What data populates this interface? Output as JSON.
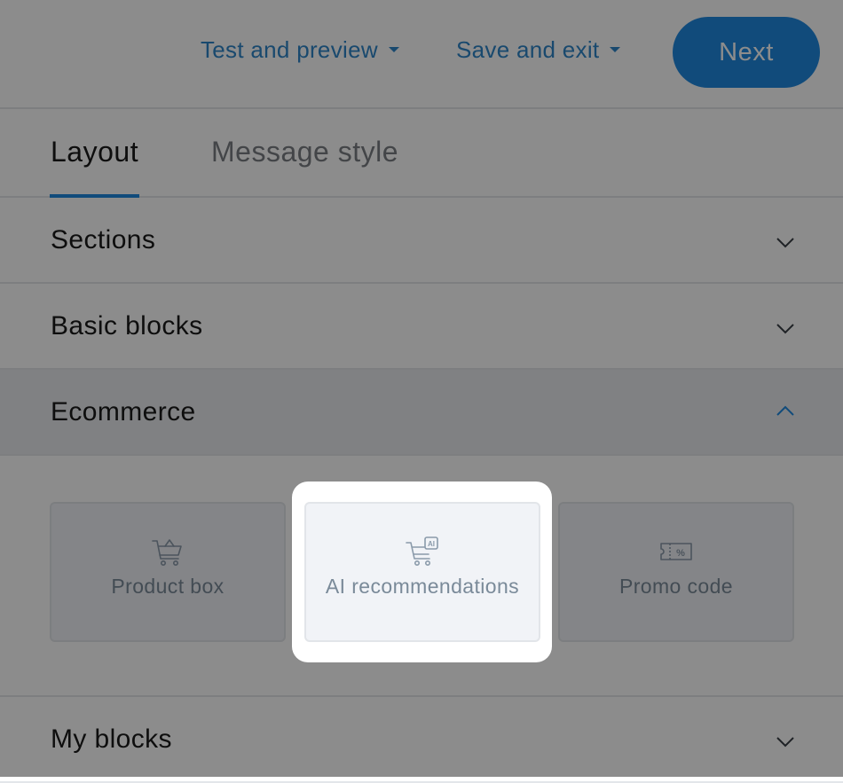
{
  "header": {
    "test_preview_label": "Test and preview",
    "save_exit_label": "Save and exit",
    "next_label": "Next"
  },
  "tabs": [
    {
      "label": "Layout",
      "active": true
    },
    {
      "label": "Message style",
      "active": false
    }
  ],
  "accordion": {
    "sections": {
      "label": "Sections",
      "expanded": false
    },
    "basic_blocks": {
      "label": "Basic blocks",
      "expanded": false
    },
    "ecommerce": {
      "label": "Ecommerce",
      "expanded": true,
      "cards": [
        {
          "label": "Product box",
          "icon": "shopping-basket-icon"
        },
        {
          "label": "AI recommendations",
          "icon": "ai-cart-icon",
          "highlighted": true
        },
        {
          "label": "Promo code",
          "icon": "coupon-icon"
        }
      ]
    },
    "my_blocks": {
      "label": "My blocks",
      "expanded": false
    }
  },
  "colors": {
    "accent": "#1f89e0",
    "link": "#2f86c9",
    "card_bg": "#f1f3f7",
    "card_text": "#7a8a99"
  }
}
